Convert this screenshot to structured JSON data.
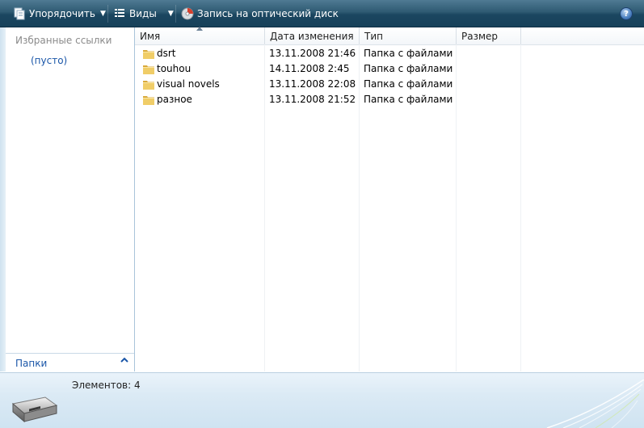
{
  "toolbar": {
    "organize_label": "Упорядочить",
    "views_label": "Виды",
    "burn_label": "Запись на оптический диск",
    "help_symbol": "?"
  },
  "left_pane": {
    "favorites_title": "Избранные ссылки",
    "favorites_empty": "(пусто)",
    "folders_label": "Папки",
    "folders_chevron": "^"
  },
  "columns": {
    "name": "Имя",
    "date": "Дата изменения",
    "type": "Тип",
    "size": "Размер"
  },
  "files": [
    {
      "name": "dsrt",
      "date": "13.11.2008 21:46",
      "type": "Папка с файлами"
    },
    {
      "name": "touhou",
      "date": "14.11.2008 2:45",
      "type": "Папка с файлами"
    },
    {
      "name": "visual novels",
      "date": "13.11.2008 22:08",
      "type": "Папка с файлами"
    },
    {
      "name": "разное",
      "date": "13.11.2008 21:52",
      "type": "Папка с файлами"
    }
  ],
  "status": {
    "count_text": "Элементов: 4"
  },
  "icons": {
    "organize": "organize-icon",
    "views": "views-icon",
    "burn": "burn-disc-icon",
    "folder": "folder-icon",
    "drive": "hard-drive-icon"
  },
  "colors": {
    "toolbar": "#1b4660",
    "link": "#1a56a8",
    "folder": "#e8c15a"
  }
}
